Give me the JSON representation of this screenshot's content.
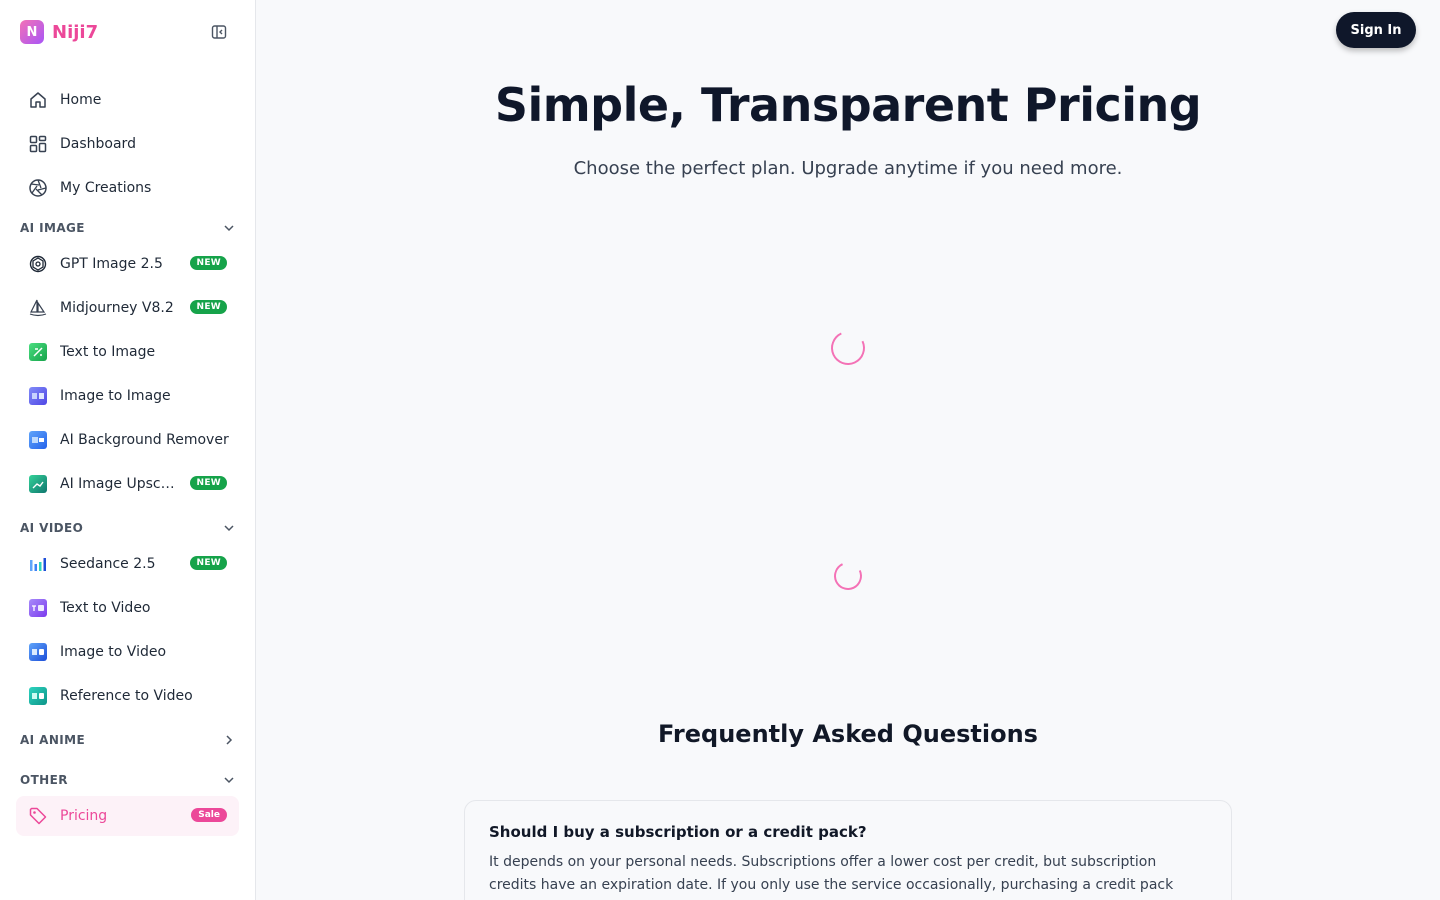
{
  "brand": {
    "logo_letter": "N",
    "name": "Niji7",
    "accent": "#ec4899"
  },
  "sidebar": {
    "top_items": [
      {
        "label": "Home",
        "icon": "home-icon"
      },
      {
        "label": "Dashboard",
        "icon": "dashboard-icon"
      },
      {
        "label": "My Creations",
        "icon": "aperture-icon"
      }
    ],
    "sections": {
      "ai_image": {
        "title": "AI IMAGE",
        "expanded": true,
        "items": [
          {
            "label": "GPT Image 2.5",
            "icon": "openai-icon",
            "badge": "NEW"
          },
          {
            "label": "Midjourney V8.2",
            "icon": "sailboat-icon",
            "badge": "NEW"
          },
          {
            "label": "Text to Image",
            "icon": "text-to-image-icon"
          },
          {
            "label": "Image to Image",
            "icon": "image-to-image-icon"
          },
          {
            "label": "AI Background Remover",
            "icon": "background-remover-icon"
          },
          {
            "label": "AI Image Upscaler",
            "icon": "image-upscaler-icon",
            "badge": "NEW"
          }
        ]
      },
      "ai_video": {
        "title": "AI VIDEO",
        "expanded": true,
        "items": [
          {
            "label": "Seedance 2.5",
            "icon": "seedance-icon",
            "badge": "NEW"
          },
          {
            "label": "Text to Video",
            "icon": "text-to-video-icon"
          },
          {
            "label": "Image to Video",
            "icon": "image-to-video-icon"
          },
          {
            "label": "Reference to Video",
            "icon": "reference-to-video-icon"
          }
        ]
      },
      "ai_anime": {
        "title": "AI ANIME",
        "expanded": false
      },
      "other": {
        "title": "OTHER",
        "expanded": true,
        "items": [
          {
            "label": "Pricing",
            "icon": "tag-icon",
            "badge": "Sale",
            "active": true
          }
        ]
      }
    }
  },
  "header": {
    "signin_label": "Sign In"
  },
  "hero": {
    "title": "Simple, Transparent Pricing",
    "subtitle": "Choose the perfect plan. Upgrade anytime if you need more."
  },
  "faq": {
    "title": "Frequently Asked Questions",
    "items": [
      {
        "question": "Should I buy a subscription or a credit pack?",
        "answer": "It depends on your personal needs. Subscriptions offer a lower cost per credit, but subscription credits have an expiration date. If you only use the service occasionally, purchasing a credit pack directly is the better"
      }
    ]
  },
  "colors": {
    "new_badge": "#16a34a",
    "sale_badge": "#ec4899",
    "spinner": "#f472b6",
    "signin_bg": "#0f172a"
  }
}
